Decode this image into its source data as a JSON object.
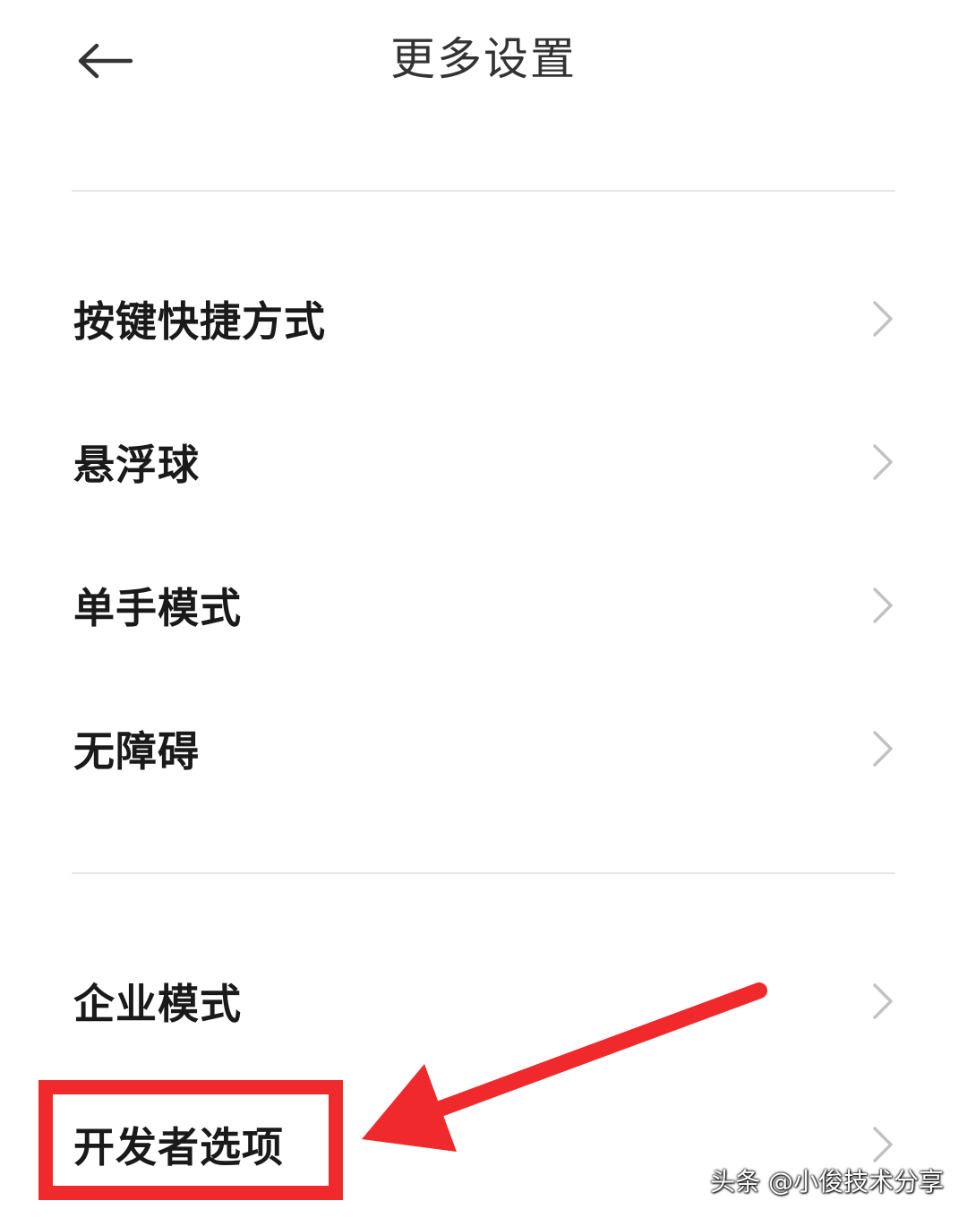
{
  "header": {
    "title": "更多设置",
    "back_icon": "arrow-left-icon"
  },
  "group1": {
    "items": [
      {
        "label": "按键快捷方式",
        "icon": "chevron-right-icon"
      },
      {
        "label": "悬浮球",
        "icon": "chevron-right-icon"
      },
      {
        "label": "单手模式",
        "icon": "chevron-right-icon"
      },
      {
        "label": "无障碍",
        "icon": "chevron-right-icon"
      }
    ]
  },
  "group2": {
    "items": [
      {
        "label": "企业模式",
        "icon": "chevron-right-icon"
      },
      {
        "label": "开发者选项",
        "icon": "chevron-right-icon"
      }
    ]
  },
  "annotation": {
    "highlight_color": "#f0292d",
    "target": "开发者选项"
  },
  "watermark": {
    "text": "头条 @小俊技术分享"
  }
}
